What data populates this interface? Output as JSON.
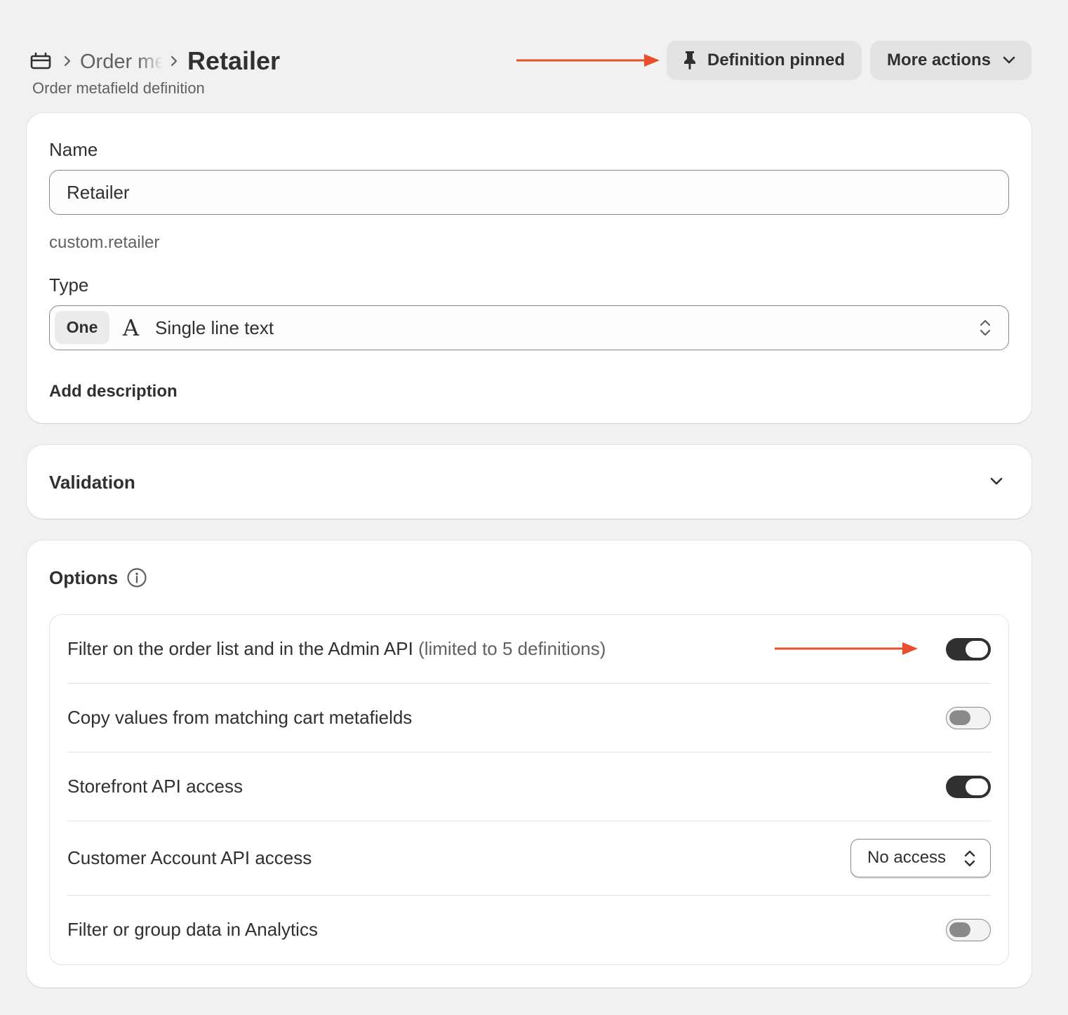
{
  "header": {
    "breadcrumb_parent": "Order metafields",
    "title": "Retailer",
    "subtitle": "Order metafield definition",
    "pinned_button": "Definition pinned",
    "more_actions_button": "More actions"
  },
  "definition": {
    "name_label": "Name",
    "name_value": "Retailer",
    "namespace_key": "custom.retailer",
    "type_label": "Type",
    "type_cardinality": "One",
    "type_glyph": "A",
    "type_value": "Single line text",
    "add_description": "Add description"
  },
  "validation": {
    "title": "Validation"
  },
  "options": {
    "title": "Options",
    "rows": [
      {
        "label": "Filter on the order list and in the Admin API",
        "note": "(limited to 5 definitions)",
        "control": "toggle",
        "enabled": true
      },
      {
        "label": "Copy values from matching cart metafields",
        "control": "toggle",
        "enabled": false
      },
      {
        "label": "Storefront API access",
        "control": "toggle",
        "enabled": true
      },
      {
        "label": "Customer Account API access",
        "control": "select",
        "value": "No access"
      },
      {
        "label": "Filter or group data in Analytics",
        "control": "toggle",
        "enabled": false
      }
    ]
  },
  "icons": {
    "breadcrumb": "metafield-box-icon",
    "pin": "pin-icon",
    "more_chevron": "chevron-down-icon",
    "type_select": "select-updown-icon",
    "info": "info-icon"
  },
  "colors": {
    "background": "#f1f1f1",
    "card": "#ffffff",
    "text": "#303030",
    "muted_text": "#616161",
    "toggle_on": "#303030",
    "annotation_arrow": "#e8502d"
  }
}
